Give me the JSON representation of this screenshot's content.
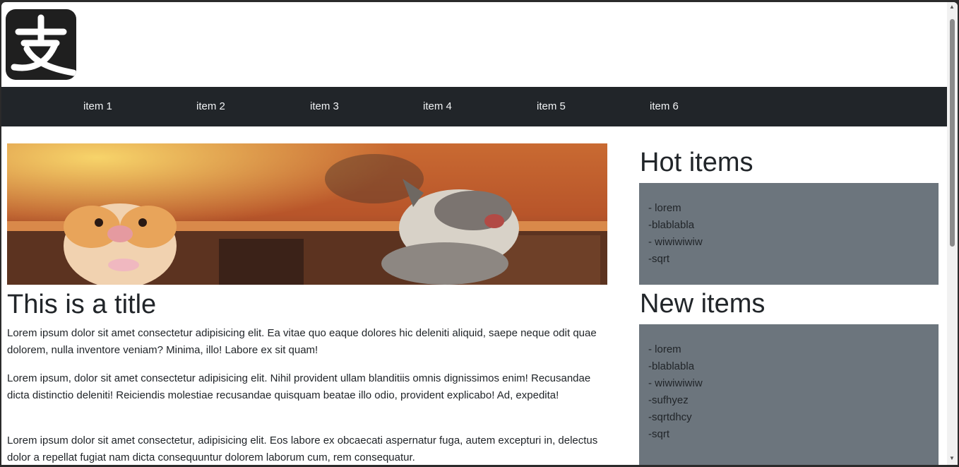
{
  "nav": {
    "items": [
      "item 1",
      "item 2",
      "item 3",
      "item 4",
      "item 5",
      "item 6"
    ]
  },
  "logo": {
    "glyph": "支"
  },
  "main": {
    "title": "This is a title",
    "paragraphs": [
      "Lorem ipsum dolor sit amet consectetur adipisicing elit. Ea vitae quo eaque dolores hic deleniti aliquid, saepe neque odit quae dolorem, nulla inventore veniam? Minima, illo! Labore ex sit quam!",
      "Lorem ipsum, dolor sit amet consectetur adipisicing elit. Nihil provident ullam blanditiis omnis dignissimos enim! Recusandae dicta distinctio deleniti! Reiciendis molestiae recusandae quisquam beatae illo odio, provident explicabo! Ad, expedita!",
      "Lorem ipsum dolor sit amet consectetur, adipisicing elit. Eos labore ex obcaecati aspernatur fuga, autem excepturi in, delectus dolor a repellat fugiat nam dicta consequuntur dolorem laborum cum, rem consequatur."
    ]
  },
  "sidebar": {
    "hot": {
      "heading": "Hot items",
      "items": [
        "- lorem",
        "-blablabla",
        "- wiwiwiwiw",
        "-sqrt"
      ]
    },
    "new": {
      "heading": "New items",
      "items": [
        "- lorem",
        "-blablabla",
        "- wiwiwiwiw",
        "-sufhyez",
        "-sqrtdhcy",
        "-sqrt"
      ]
    }
  },
  "colors": {
    "navbar": "#212529",
    "sidebox": "#6c757d",
    "logo_bg": "#1f1f1f"
  }
}
